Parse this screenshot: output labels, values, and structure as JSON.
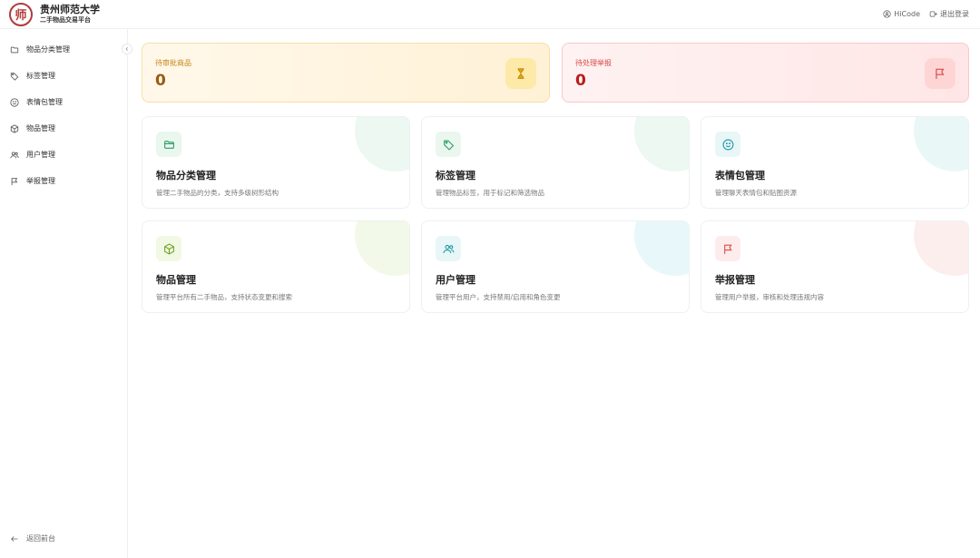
{
  "header": {
    "title": "贵州师范大学",
    "subtitle": "二手物品交易平台",
    "logo_char": "师",
    "user": "HiCode",
    "logout": "退出登录"
  },
  "sidebar": {
    "items": [
      {
        "label": "物品分类管理",
        "icon": "folder-icon"
      },
      {
        "label": "标签管理",
        "icon": "tag-icon"
      },
      {
        "label": "表情包管理",
        "icon": "smile-icon"
      },
      {
        "label": "物品管理",
        "icon": "box-icon"
      },
      {
        "label": "用户管理",
        "icon": "users-icon"
      },
      {
        "label": "举报管理",
        "icon": "flag-icon"
      }
    ],
    "back": "返回前台"
  },
  "stats": {
    "pending": {
      "label": "待审批商品",
      "value": "0"
    },
    "reports": {
      "label": "待处理举报",
      "value": "0"
    }
  },
  "cards": [
    {
      "title": "物品分类管理",
      "desc": "管理二手物品的分类，支持多级树形结构",
      "icon": "folder-icon",
      "color": "#2e9b63"
    },
    {
      "title": "标签管理",
      "desc": "管理物品标签，用于标记和筛选物品",
      "icon": "tag-icon",
      "color": "#2e9b63"
    },
    {
      "title": "表情包管理",
      "desc": "管理聊天表情包和贴图资源",
      "icon": "smile-icon",
      "color": "#1f9aa3"
    },
    {
      "title": "物品管理",
      "desc": "管理平台所有二手物品，支持状态变更和搜索",
      "icon": "box-icon",
      "color": "#6aa424"
    },
    {
      "title": "用户管理",
      "desc": "管理平台用户，支持禁用/启用和角色变更",
      "icon": "users-icon",
      "color": "#1f9aa3"
    },
    {
      "title": "举报管理",
      "desc": "管理用户举报，审核和处理违规内容",
      "icon": "flag-icon",
      "color": "#d94a4a"
    }
  ]
}
